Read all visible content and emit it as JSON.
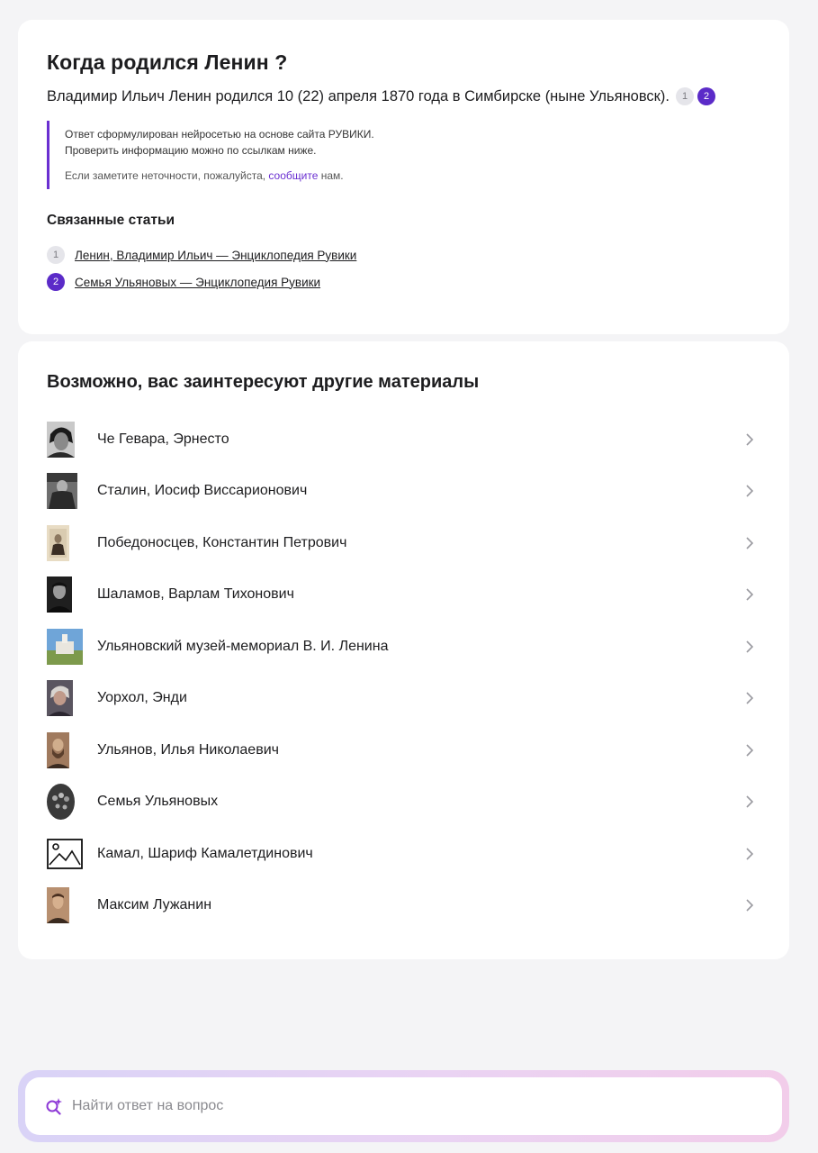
{
  "answer": {
    "question": "Когда родился Ленин ?",
    "text": "Владимир Ильич Ленин родился 10 (22) апреля 1870 года в Симбирске (ныне Ульяновск).",
    "refs": [
      "1",
      "2"
    ],
    "disclaimer": {
      "line1": "Ответ сформулирован нейросетью на основе сайта РУВИКИ.",
      "line2": "Проверить информацию можно по ссылкам ниже.",
      "report_prefix": "Если заметите неточности, пожалуйста, ",
      "report_link": "сообщите",
      "report_suffix": " нам."
    },
    "related_title": "Связанные статьи",
    "related": [
      {
        "num": "1",
        "label": "Ленин, Владимир Ильич — Энциклопедия Рувики"
      },
      {
        "num": "2",
        "label": "Семья Ульяновых — Энциклопедия Рувики"
      }
    ]
  },
  "more": {
    "title": "Возможно, вас заинтересуют другие материалы",
    "items": [
      {
        "label": "Че Гевара, Эрнесто"
      },
      {
        "label": "Сталин, Иосиф Виссарионович"
      },
      {
        "label": "Победоносцев, Константин Петрович"
      },
      {
        "label": "Шаламов, Варлам Тихонович"
      },
      {
        "label": "Ульяновский музей-мемориал В. И. Ленина"
      },
      {
        "label": "Уорхол, Энди"
      },
      {
        "label": "Ульянов, Илья Николаевич"
      },
      {
        "label": "Семья Ульяновых"
      },
      {
        "label": "Камал, Шариф Камалетдинович"
      },
      {
        "label": "Максим Лужанин"
      }
    ]
  },
  "search": {
    "placeholder": "Найти ответ на вопрос"
  },
  "colors": {
    "accent": "#5b2bc8",
    "page_bg": "#f4f4f6",
    "card_bg": "#ffffff"
  }
}
